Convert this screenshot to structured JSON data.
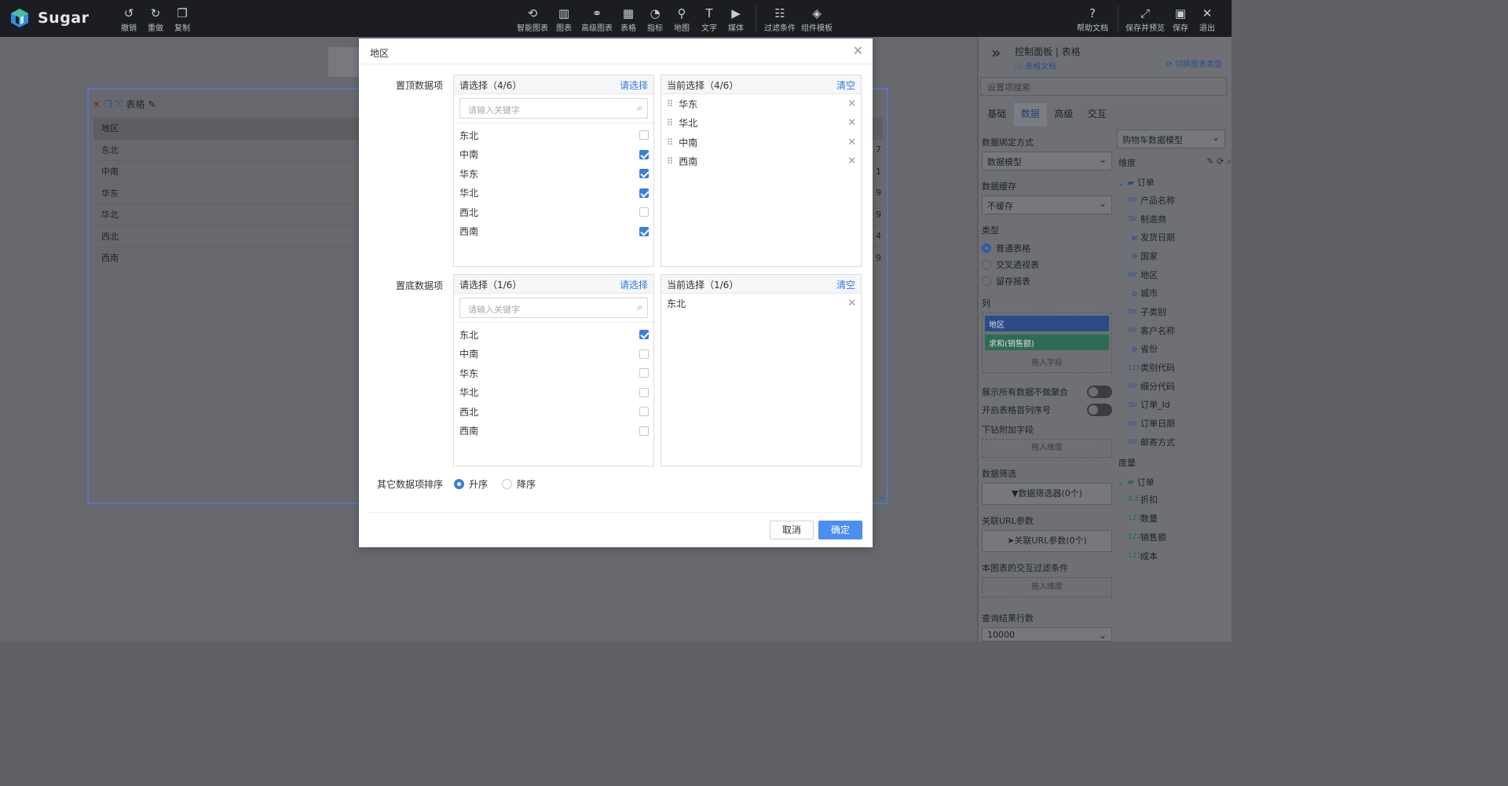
{
  "app": {
    "name": "Sugar",
    "colors": {
      "accent": "#4a8ef0",
      "link": "#2f7be6",
      "topbar": "#1b1d22",
      "checked": "#3a7fe0"
    }
  },
  "toolbar": {
    "left": [
      {
        "label": "撤销",
        "icon": "undo-icon"
      },
      {
        "label": "重做",
        "icon": "redo-icon"
      },
      {
        "label": "复制",
        "icon": "copy-icon"
      }
    ],
    "center": [
      {
        "label": "智能图表",
        "icon": "smart-chart-icon"
      },
      {
        "label": "图表",
        "icon": "bar-chart-icon"
      },
      {
        "label": "高级图表",
        "icon": "advanced-chart-icon"
      },
      {
        "label": "表格",
        "icon": "table-icon"
      },
      {
        "label": "指标",
        "icon": "gauge-icon"
      },
      {
        "label": "地图",
        "icon": "map-pin-icon"
      },
      {
        "label": "文字",
        "icon": "text-icon"
      },
      {
        "label": "媒体",
        "icon": "media-icon"
      },
      {
        "label": "过滤条件",
        "icon": "filter-icon"
      },
      {
        "label": "组件模板",
        "icon": "template-icon"
      }
    ],
    "right": [
      {
        "label": "帮助文档",
        "icon": "help-icon"
      },
      {
        "label": "保存并预览",
        "icon": "expand-icon"
      },
      {
        "label": "保存",
        "icon": "save-icon"
      },
      {
        "label": "退出",
        "icon": "exit-icon"
      }
    ]
  },
  "widget": {
    "title": "表格",
    "column_header": "地区",
    "rows": [
      "东北",
      "中南",
      "华东",
      "华北",
      "西北",
      "西南"
    ],
    "right_values": [
      "7",
      "1",
      "9",
      "9",
      "4",
      "9"
    ]
  },
  "panel": {
    "title": "控制面板 | 表格",
    "doc_link": "表格文档",
    "switch_link": "切换图表类型",
    "search_placeholder": "设置项搜索",
    "tabs": [
      "基础",
      "数据",
      "高级",
      "交互"
    ],
    "active_tab": "数据",
    "binding_label": "数据绑定方式",
    "binding_value": "数据模型",
    "cache_label": "数据缓存",
    "cache_value": "不缓存",
    "type_label": "类型",
    "types": [
      "普通表格",
      "交叉透视表",
      "留存报表"
    ],
    "selected_type": "普通表格",
    "columns_label": "列",
    "column_pills": [
      "地区",
      "求和(销售额)"
    ],
    "drop_field": "拖入字段",
    "toggle1": "展示所有数据不做聚合",
    "toggle2": "开启表格首列序号",
    "drill_label": "下钻附加字段",
    "drop_dimension": "拖入维度",
    "filter_label": "数据筛选",
    "filter_btn": "数据筛选器(0个)",
    "url_label": "关联URL参数",
    "url_btn": "关联URL参数(0个)",
    "interaction_label": "本图表的交互过滤条件",
    "drop_dimension2": "拖入维度",
    "rows_label": "查询结果行数",
    "rows_value": "10000",
    "model_value": "购物车数据模型",
    "dimension_label": "维度",
    "dimension_folder": "订单",
    "dimensions": [
      {
        "type": "Str",
        "name": "产品名称"
      },
      {
        "type": "Str",
        "name": "制造商"
      },
      {
        "type": "date",
        "name": "发货日期"
      },
      {
        "type": "geo",
        "name": "国家"
      },
      {
        "type": "Str",
        "name": "地区"
      },
      {
        "type": "geo",
        "name": "城市"
      },
      {
        "type": "Str",
        "name": "子类别"
      },
      {
        "type": "Str",
        "name": "客户名称"
      },
      {
        "type": "geo",
        "name": "省份"
      },
      {
        "type": "123",
        "name": "类别代码"
      },
      {
        "type": "Str",
        "name": "细分代码"
      },
      {
        "type": "Str",
        "name": "订单_Id"
      },
      {
        "type": "Str",
        "name": "订单日期"
      },
      {
        "type": "Str",
        "name": "邮寄方式"
      }
    ],
    "measure_label": "度量",
    "measure_folder": "订单",
    "measures": [
      {
        "type": "0.5",
        "name": "折扣"
      },
      {
        "type": "123",
        "name": "数量"
      },
      {
        "type": "123",
        "name": "销售额"
      },
      {
        "type": "123",
        "name": "成本"
      }
    ]
  },
  "modal": {
    "title": "地区",
    "top_section_label": "置顶数据项",
    "bottom_section_label": "置底数据项",
    "top": {
      "left_header": "请选择（4/6）",
      "left_action": "请选择",
      "search_placeholder": "请输入关键字",
      "options": [
        {
          "label": "东北",
          "checked": false
        },
        {
          "label": "中南",
          "checked": true
        },
        {
          "label": "华东",
          "checked": true
        },
        {
          "label": "华北",
          "checked": true
        },
        {
          "label": "西北",
          "checked": false
        },
        {
          "label": "西南",
          "checked": true
        }
      ],
      "right_header": "当前选择（4/6）",
      "right_action": "清空",
      "selected": [
        "华东",
        "华北",
        "中南",
        "西南"
      ]
    },
    "bottom": {
      "left_header": "请选择（1/6）",
      "left_action": "请选择",
      "search_placeholder": "请输入关键字",
      "options": [
        {
          "label": "东北",
          "checked": true
        },
        {
          "label": "中南",
          "checked": false
        },
        {
          "label": "华东",
          "checked": false
        },
        {
          "label": "华北",
          "checked": false
        },
        {
          "label": "西北",
          "checked": false
        },
        {
          "label": "西南",
          "checked": false
        }
      ],
      "right_header": "当前选择（1/6）",
      "right_action": "清空",
      "selected": [
        "东北"
      ]
    },
    "sort_label": "其它数据项排序",
    "sort_options": [
      "升序",
      "降序"
    ],
    "sort_selected": "升序",
    "cancel": "取消",
    "ok": "确定"
  }
}
